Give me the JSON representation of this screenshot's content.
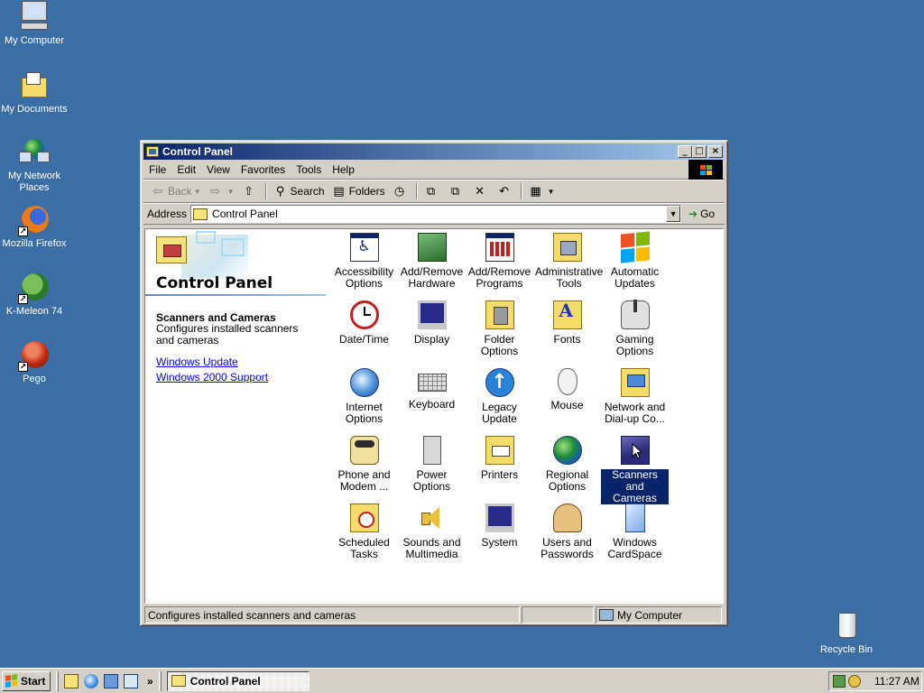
{
  "desktop": {
    "icons": [
      {
        "label": "My Computer"
      },
      {
        "label": "My Documents"
      },
      {
        "label": "My Network Places"
      },
      {
        "label": "Mozilla Firefox"
      },
      {
        "label": "K-Meleon 74"
      },
      {
        "label": "Pego"
      },
      {
        "label": "Recycle Bin"
      }
    ]
  },
  "window": {
    "title": "Control Panel",
    "buttons": {
      "minimize": "_",
      "maximize": "□",
      "close": "×"
    },
    "menu": [
      "File",
      "Edit",
      "View",
      "Favorites",
      "Tools",
      "Help"
    ],
    "toolbar": {
      "back": "Back",
      "search": "Search",
      "folders": "Folders"
    },
    "address": {
      "label": "Address",
      "value": "Control Panel",
      "go": "Go"
    },
    "left_pane": {
      "title": "Control Panel",
      "selected_name": "Scanners and Cameras",
      "selected_desc": "Configures installed scanners and cameras",
      "links": [
        "Windows Update",
        "Windows 2000 Support"
      ]
    },
    "items": [
      {
        "label": "Accessibility Options",
        "icon": "accessibility-icon"
      },
      {
        "label": "Add/Remove Hardware",
        "icon": "hardware-icon"
      },
      {
        "label": "Add/Remove Programs",
        "icon": "programs-icon"
      },
      {
        "label": "Administrative Tools",
        "icon": "admin-tools-icon"
      },
      {
        "label": "Automatic Updates",
        "icon": "windows-flag-icon"
      },
      {
        "label": "Date/Time",
        "icon": "clock-icon"
      },
      {
        "label": "Display",
        "icon": "monitor-icon"
      },
      {
        "label": "Folder Options",
        "icon": "folder-options-icon"
      },
      {
        "label": "Fonts",
        "icon": "fonts-icon"
      },
      {
        "label": "Gaming Options",
        "icon": "joystick-icon"
      },
      {
        "label": "Internet Options",
        "icon": "ie-globe-icon"
      },
      {
        "label": "Keyboard",
        "icon": "keyboard-icon"
      },
      {
        "label": "Legacy Update",
        "icon": "legacy-update-icon"
      },
      {
        "label": "Mouse",
        "icon": "mouse-icon"
      },
      {
        "label": "Network and Dial-up Co...",
        "icon": "network-folder-icon"
      },
      {
        "label": "Phone and Modem ...",
        "icon": "phone-icon"
      },
      {
        "label": "Power Options",
        "icon": "power-plug-icon"
      },
      {
        "label": "Printers",
        "icon": "printer-icon"
      },
      {
        "label": "Regional Options",
        "icon": "globe-icon"
      },
      {
        "label": "Scanners and Cameras",
        "icon": "scanner-icon",
        "selected": true
      },
      {
        "label": "Scheduled Tasks",
        "icon": "scheduled-tasks-icon"
      },
      {
        "label": "Sounds and Multimedia",
        "icon": "speaker-icon"
      },
      {
        "label": "System",
        "icon": "computer-icon"
      },
      {
        "label": "Users and Passwords",
        "icon": "users-icon"
      },
      {
        "label": "Windows CardSpace",
        "icon": "cardspace-icon"
      }
    ],
    "status": {
      "text": "Configures installed scanners and cameras",
      "zone": "My Computer"
    }
  },
  "taskbar": {
    "start": "Start",
    "more": "»",
    "task": "Control Panel",
    "clock": "11:27 AM"
  }
}
